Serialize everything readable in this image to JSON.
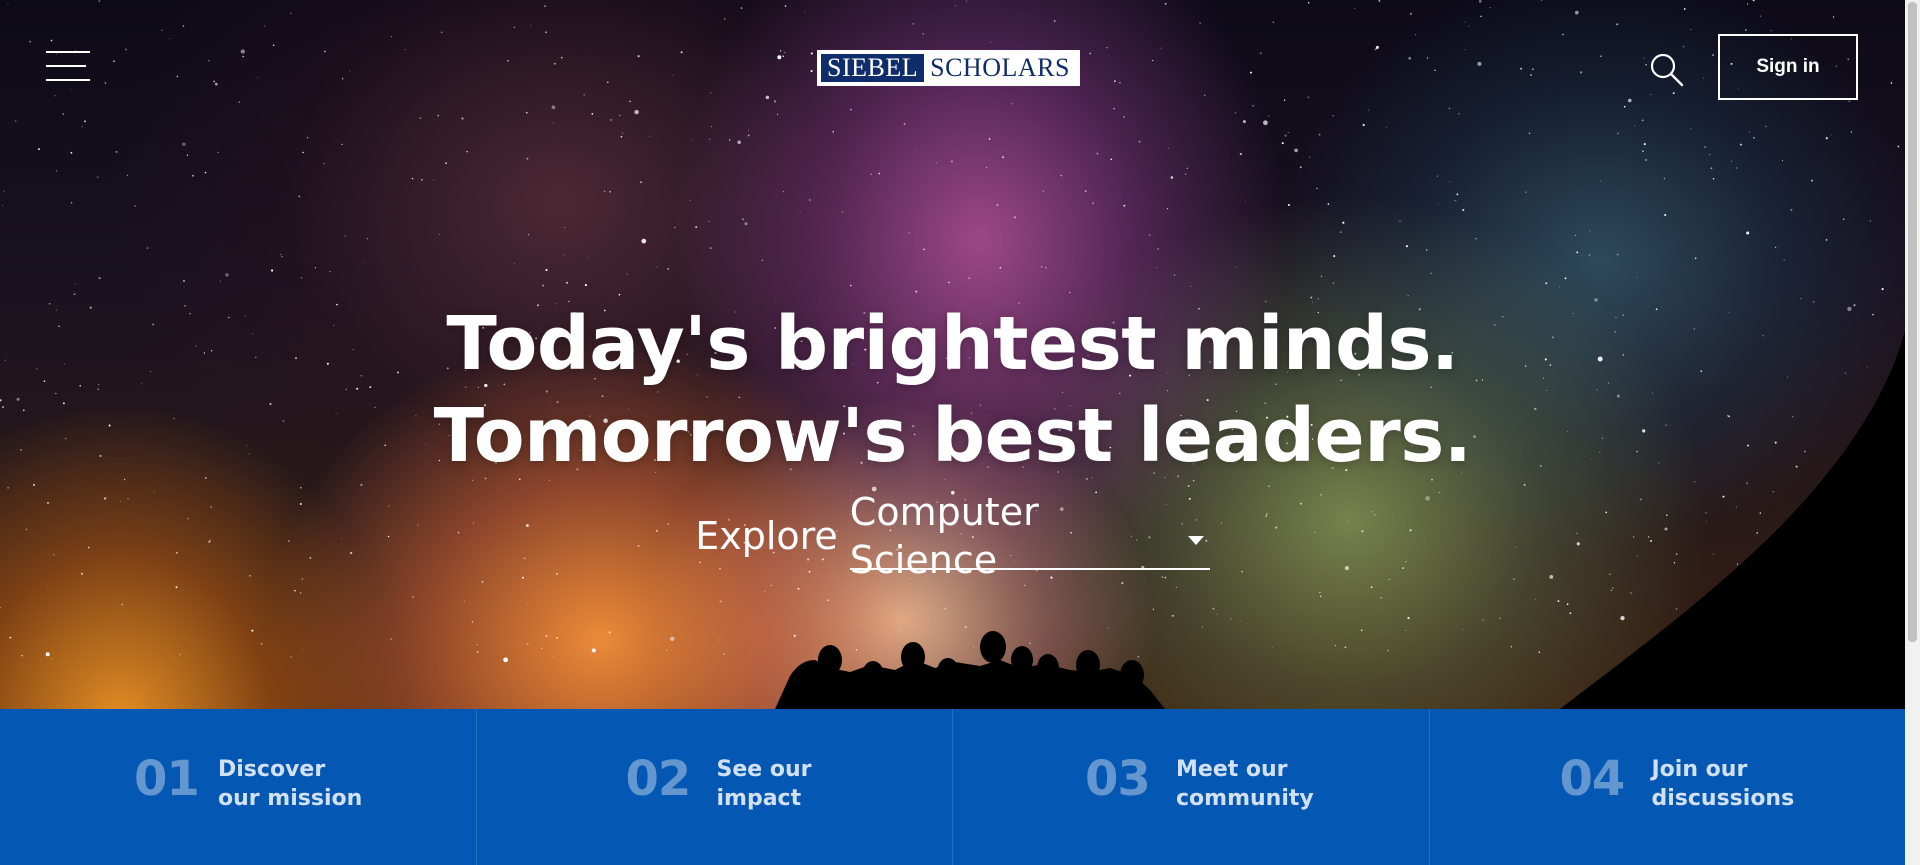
{
  "header": {
    "menu_icon": "hamburger-menu-icon",
    "logo": {
      "left": "SIEBEL",
      "right": "SCHOLARS",
      "colors": {
        "navy": "#0f2d6b",
        "white": "#ffffff"
      }
    },
    "search_icon": "search-icon",
    "signin_label": "Sign in"
  },
  "hero": {
    "headline_line1": "Today's brightest minds.",
    "headline_line2": "Tomorrow's best leaders.",
    "explore_label": "Explore",
    "explore_selected": "Computer Science"
  },
  "bottom_nav": {
    "background": "#0557b4",
    "items": [
      {
        "number": "01",
        "line1": "Discover",
        "line2": "our mission"
      },
      {
        "number": "02",
        "line1": "See our",
        "line2": "impact"
      },
      {
        "number": "03",
        "line1": "Meet our",
        "line2": "community"
      },
      {
        "number": "04",
        "line1": "Join our",
        "line2": "discussions"
      }
    ]
  }
}
